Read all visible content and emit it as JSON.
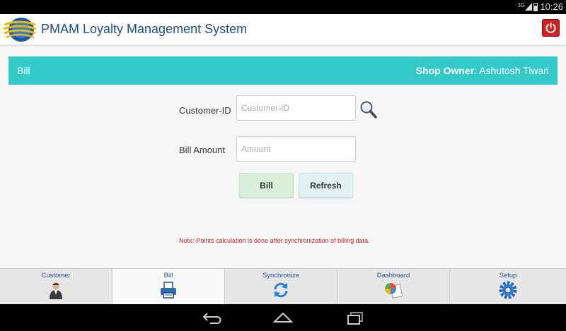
{
  "status_bar": {
    "network": "3G",
    "time": "10:26"
  },
  "app": {
    "title": "PMAM Loyalty Management System"
  },
  "banner": {
    "section": "Bill",
    "owner_label": "Shop Owner",
    "owner_separator": ":",
    "owner_name": "Ashutosh Tiwari"
  },
  "form": {
    "customer_id": {
      "label": "Customer-ID",
      "placeholder": "Customer-ID",
      "value": ""
    },
    "amount": {
      "label": "Bill Amount",
      "placeholder": "Amount",
      "value": ""
    },
    "bill_button": "Bill",
    "refresh_button": "Refresh"
  },
  "note": "Note:-Points calculation is done after synchronization of billing data.",
  "tabs": [
    {
      "label": "Customer",
      "icon": "customer-icon"
    },
    {
      "label": "Bill",
      "icon": "printer-icon",
      "active": true
    },
    {
      "label": "Synchronize",
      "icon": "sync-icon"
    },
    {
      "label": "Dashboard",
      "icon": "dashboard-chart-icon"
    },
    {
      "label": "Setup",
      "icon": "gear-icon"
    }
  ],
  "colors": {
    "banner": "#33c9c9",
    "title": "#1f4e8c",
    "note": "#d42020",
    "power": "#d32020"
  }
}
